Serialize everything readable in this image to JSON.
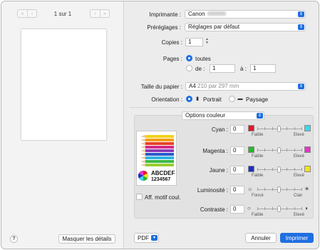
{
  "preview": {
    "page_label": "1 sur 1",
    "details_button": "Masquer les détails",
    "help_label": "?"
  },
  "printer": {
    "label": "Imprimante :",
    "value": "Canon"
  },
  "presets": {
    "label": "Préréglages :",
    "value": "Réglages par défaut"
  },
  "copies": {
    "label": "Copies :",
    "value": "1"
  },
  "pages": {
    "label": "Pages :",
    "all_label": "toutes",
    "range_label": "de :",
    "from_value": "1",
    "to_label": "à :",
    "to_value": "1"
  },
  "paper": {
    "label": "Taille du papier :",
    "size": "A4",
    "detail": "210 par 297 mm"
  },
  "orientation": {
    "label": "Orientation :",
    "portrait": "Portrait",
    "landscape": "Paysage"
  },
  "section_popup": "Options couleur",
  "sample_text": {
    "line1": "ABCDEF",
    "line2": "1234567"
  },
  "show_pattern_label": "Aff. motif coul.",
  "sliders": [
    {
      "label": "Cyan :",
      "value": "0",
      "low": "Faible",
      "high": "Elevé",
      "level": 0,
      "low_color": "#e0192b",
      "high_color": "#3fd5e8"
    },
    {
      "label": "Magenta :",
      "value": "0",
      "low": "Faible",
      "high": "Elevé",
      "level": 0,
      "low_color": "#27b82d",
      "high_color": "#e436c6"
    },
    {
      "label": "Jaune :",
      "value": "0",
      "low": "Faible",
      "high": "Elevé",
      "level": 0,
      "low_color": "#1c2ec4",
      "high_color": "#f2e21a"
    },
    {
      "label": "Luminosité :",
      "value": "0",
      "low": "Foncé",
      "high": "Clair",
      "level": 0,
      "low_icon": "sun-dim-icon",
      "high_icon": "sun-bright-icon"
    },
    {
      "label": "Contraste :",
      "value": "0",
      "low": "Faible",
      "high": "Elevé",
      "level": 0,
      "low_icon": "contrast-low-icon",
      "high_icon": "contrast-high-icon"
    }
  ],
  "footer": {
    "pdf_label": "PDF",
    "cancel_label": "Annuler",
    "print_label": "Imprimer"
  },
  "colors": {
    "accent": "#1f6fe0"
  }
}
